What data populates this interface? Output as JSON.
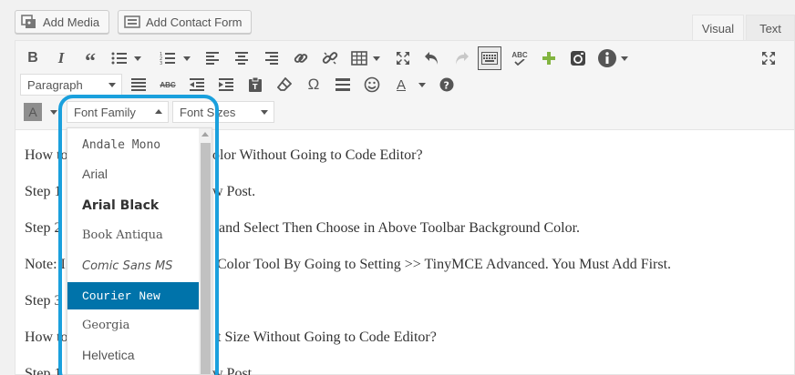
{
  "buttons": {
    "add_media": "Add Media",
    "add_contact_form": "Add Contact Form"
  },
  "tabs": {
    "visual": "Visual",
    "text": "Text"
  },
  "toolbar": {
    "format_select": "Paragraph",
    "font_family_select": "Font Family",
    "font_sizes_select": "Font Sizes",
    "omega": "Ω",
    "bg_color_letter": "A",
    "text_color_letter": "A",
    "abc": "ABC"
  },
  "font_family_dropdown": {
    "items": [
      {
        "label": "Andale Mono",
        "selected": false
      },
      {
        "label": "Arial",
        "selected": false
      },
      {
        "label": "Arial Black",
        "selected": false
      },
      {
        "label": "Book Antiqua",
        "selected": false
      },
      {
        "label": "Comic Sans MS",
        "selected": false
      },
      {
        "label": "Courier New",
        "selected": true
      },
      {
        "label": "Georgia",
        "selected": false
      },
      {
        "label": "Helvetica",
        "selected": false
      }
    ]
  },
  "content": {
    "lines": [
      {
        "before": "How to",
        "after": "olor Without Going to Code Editor?"
      },
      {
        "before": "Step 1",
        "after": "w Post."
      },
      {
        "before": "Step 2",
        "after": "and Select Then Choose in Above Toolbar Background Color."
      },
      {
        "before": "Note: I",
        "after": "Color Tool By Going to Setting >> TinyMCE Advanced. You Must Add First."
      },
      {
        "before": "Step 3",
        "after": ""
      },
      {
        "before": "How to",
        "after": "t Size  Without Going to Code Editor?"
      },
      {
        "before": "Step 1",
        "after": "w Post"
      }
    ]
  },
  "colors": {
    "selected_item_bg": "#0073aa",
    "highlight_border": "#1aa0dd",
    "add_icon": "#82b440"
  }
}
